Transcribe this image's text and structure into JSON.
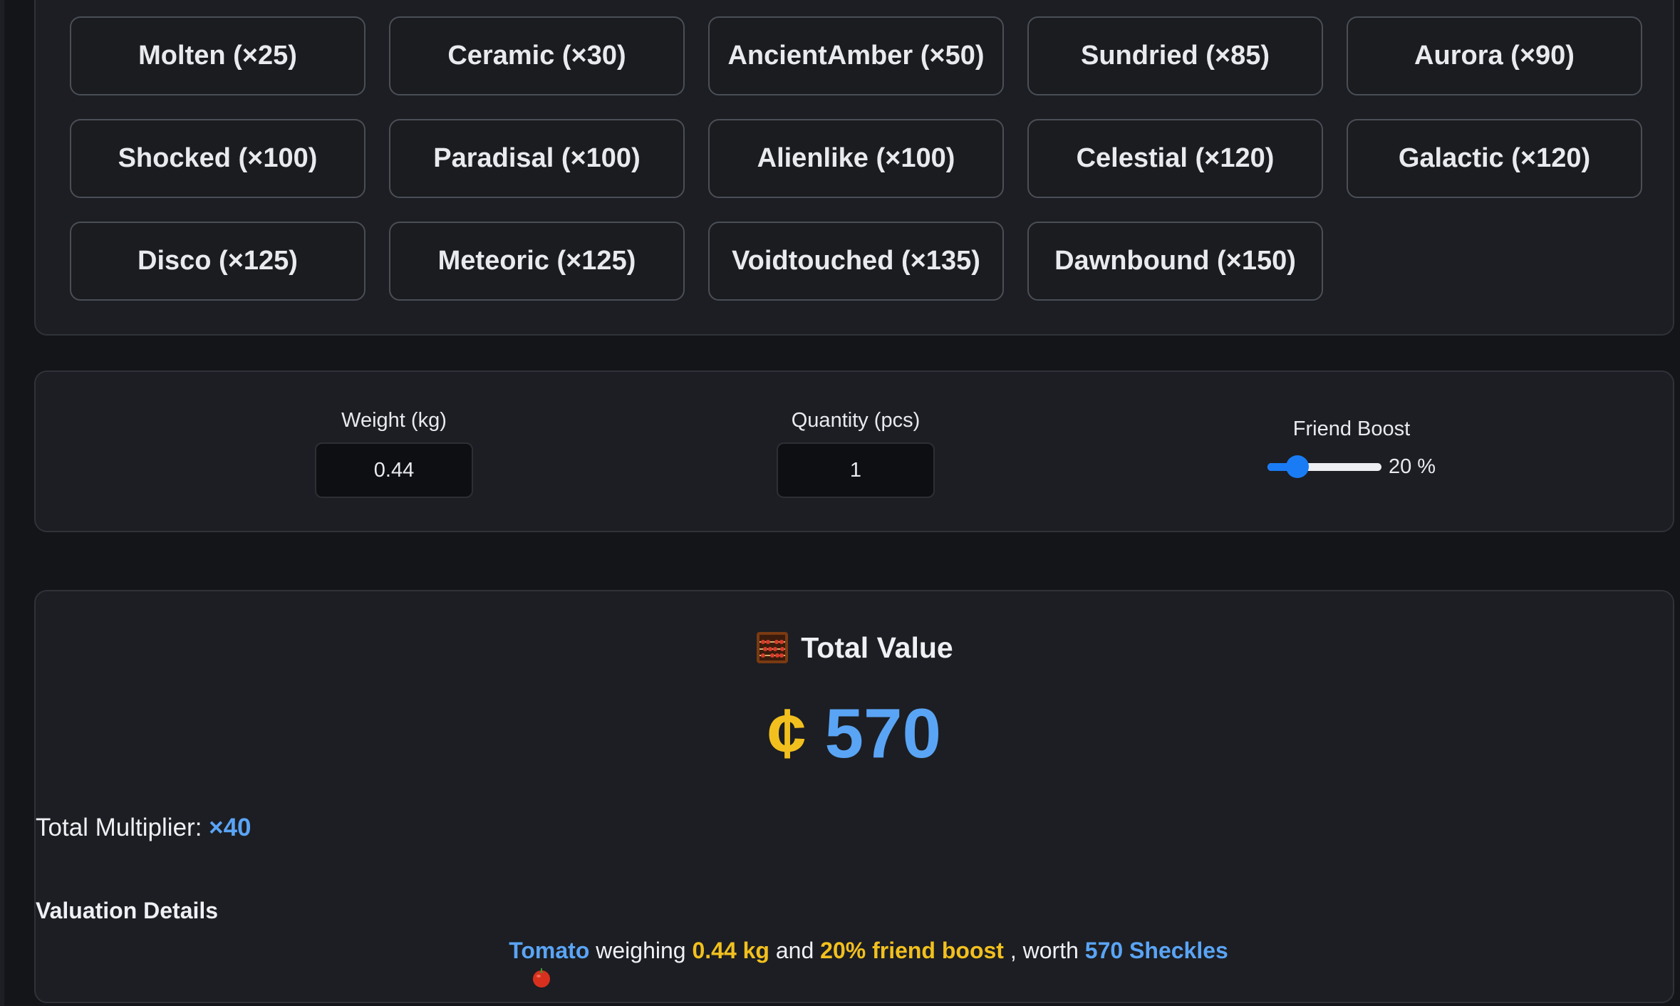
{
  "mutations": {
    "buttons": [
      {
        "label": "Molten (×25)"
      },
      {
        "label": "Ceramic (×30)"
      },
      {
        "label": "AncientAmber (×50)"
      },
      {
        "label": "Sundried (×85)"
      },
      {
        "label": "Aurora (×90)"
      },
      {
        "label": "Shocked (×100)"
      },
      {
        "label": "Paradisal (×100)"
      },
      {
        "label": "Alienlike (×100)"
      },
      {
        "label": "Celestial (×120)"
      },
      {
        "label": "Galactic (×120)"
      },
      {
        "label": "Disco (×125)"
      },
      {
        "label": "Meteoric (×125)"
      },
      {
        "label": "Voidtouched (×135)"
      },
      {
        "label": "Dawnbound (×150)"
      }
    ]
  },
  "inputs": {
    "weight": {
      "label": "Weight (kg)",
      "value": "0.44"
    },
    "quantity": {
      "label": "Quantity (pcs)",
      "value": "1"
    },
    "friend_boost": {
      "label": "Friend Boost",
      "value": 20,
      "value_text": "20 %",
      "min": 0,
      "max": 100
    }
  },
  "result": {
    "title": "Total Value",
    "title_icon": "abacus-icon",
    "currency_symbol": "¢",
    "amount": "570",
    "multiplier_label": "Total Multiplier:",
    "multiplier_value": "×40",
    "details_heading": "Valuation Details",
    "details": {
      "icon": "tomato-icon",
      "crop": "Tomato",
      "text_weighing": "weighing",
      "weight": "0.44 kg",
      "text_and": "and",
      "boost": "20% friend boost",
      "text_worth": ", worth",
      "worth": "570 Sheckles"
    }
  },
  "colors": {
    "background": "#131519",
    "panel": "#1c1e23",
    "accent_blue": "#5aa4f5",
    "accent_yellow": "#f2c01e",
    "slider_blue": "#1a7cf5"
  }
}
